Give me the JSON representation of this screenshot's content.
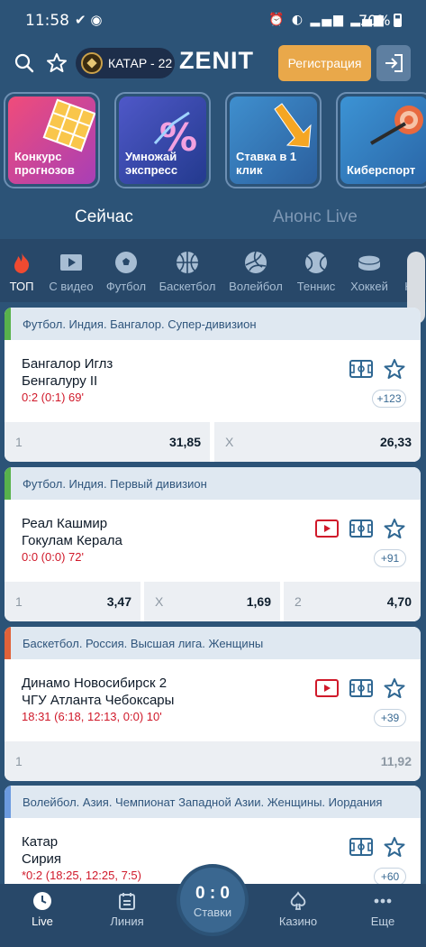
{
  "status": {
    "time": "11:58",
    "battery": "70%"
  },
  "header": {
    "cup_label": "КАТАР - 22",
    "logo": "ZENIT",
    "register_label": "Регистрация"
  },
  "promos": [
    {
      "label_line1": "Конкурс",
      "label_line2": "прогнозов"
    },
    {
      "label_line1": "Умножай",
      "label_line2": "экспресс"
    },
    {
      "label_line1": "Ставка в 1",
      "label_line2": "клик"
    },
    {
      "label_line1": "Киберспорт",
      "label_line2": ""
    }
  ],
  "tabs": {
    "now": "Сейчас",
    "announce": "Анонс Live"
  },
  "sports": [
    {
      "label": "ТОП"
    },
    {
      "label": "С видео"
    },
    {
      "label": "Футбол"
    },
    {
      "label": "Баскетбол"
    },
    {
      "label": "Волейбол"
    },
    {
      "label": "Теннис"
    },
    {
      "label": "Хоккей"
    },
    {
      "label": "Н"
    }
  ],
  "events": [
    {
      "league": "Футбол. Индия. Бангалор. Супер-дивизион",
      "accent": "#58b24c",
      "team1": "Бангалор Иглз",
      "team2": "Бенгалуру II",
      "score": "0:2 (0:1) 69'",
      "more": "+123",
      "odds": [
        {
          "key": "1",
          "value": "31,85"
        },
        {
          "key": "X",
          "value": "26,33"
        }
      ]
    },
    {
      "league": "Футбол. Индия. Первый дивизион",
      "accent": "#58b24c",
      "team1": "Реал Кашмир",
      "team2": "Гокулам Керала",
      "score": "0:0 (0:0) 72'",
      "more": "+91",
      "odds": [
        {
          "key": "1",
          "value": "3,47"
        },
        {
          "key": "X",
          "value": "1,69"
        },
        {
          "key": "2",
          "value": "4,70"
        }
      ]
    },
    {
      "league": "Баскетбол. Россия. Высшая лига. Женщины",
      "accent": "#e0623a",
      "team1": "Динамо Новосибирск 2",
      "team2": "ЧГУ Атланта Чебоксары",
      "score": "18:31 (6:18, 12:13, 0:0) 10'",
      "more": "+39",
      "odds": [
        {
          "key": "1",
          "value": "11,92"
        }
      ]
    },
    {
      "league": "Волейбол. Азия. Чемпионат Западной Азии. Женщины. Иордания",
      "accent": "#6b9be0",
      "team1": "Катар",
      "team2": "Сирия",
      "score": "*0:2 (18:25, 12:25, 7:5)",
      "more": "+60"
    }
  ],
  "bottom_nav": {
    "live": "Live",
    "line": "Линия",
    "bets_count": "0 : 0",
    "bets": "Ставки",
    "casino": "Казино",
    "more": "Еще"
  },
  "colors": {
    "background": "#2c5377",
    "accent_orange": "#e9a84a",
    "live_red": "#d0192a"
  }
}
